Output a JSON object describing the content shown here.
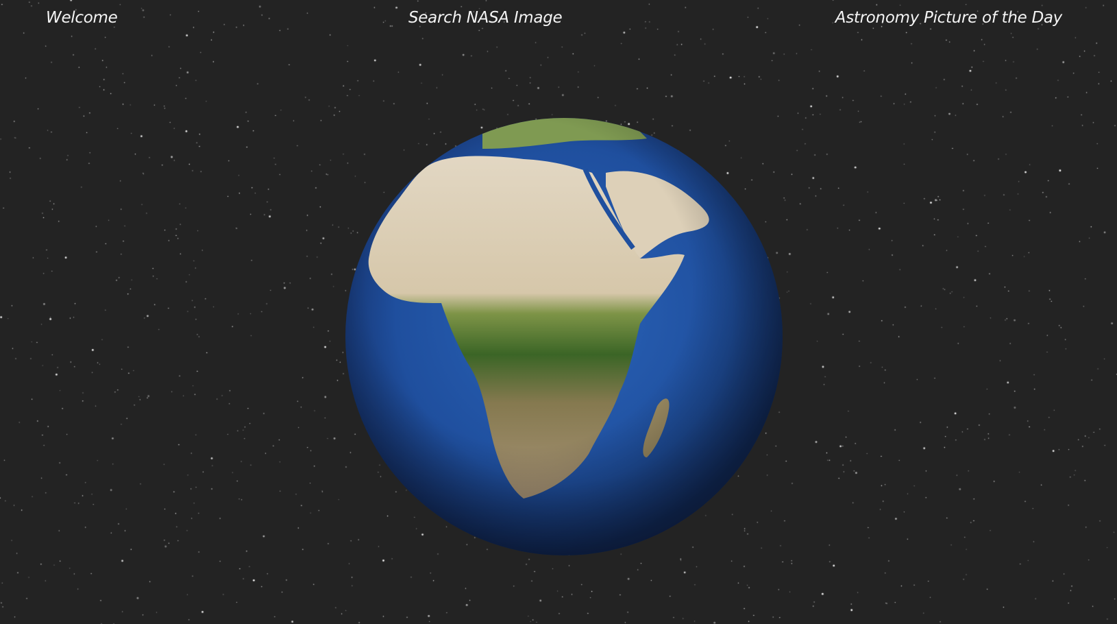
{
  "nav": {
    "welcome": "Welcome",
    "search": "Search NASA Image",
    "apod": "Astronomy Picture of the Day"
  },
  "colors": {
    "background": "#232323",
    "nav_text": "#f4f4f4",
    "ocean": "#1f4f9e",
    "desert": "#d9cdb7",
    "forest": "#3f6a2a",
    "savanna": "#9a8a63"
  },
  "globe": {
    "label": "earth-globe",
    "view": "africa"
  }
}
